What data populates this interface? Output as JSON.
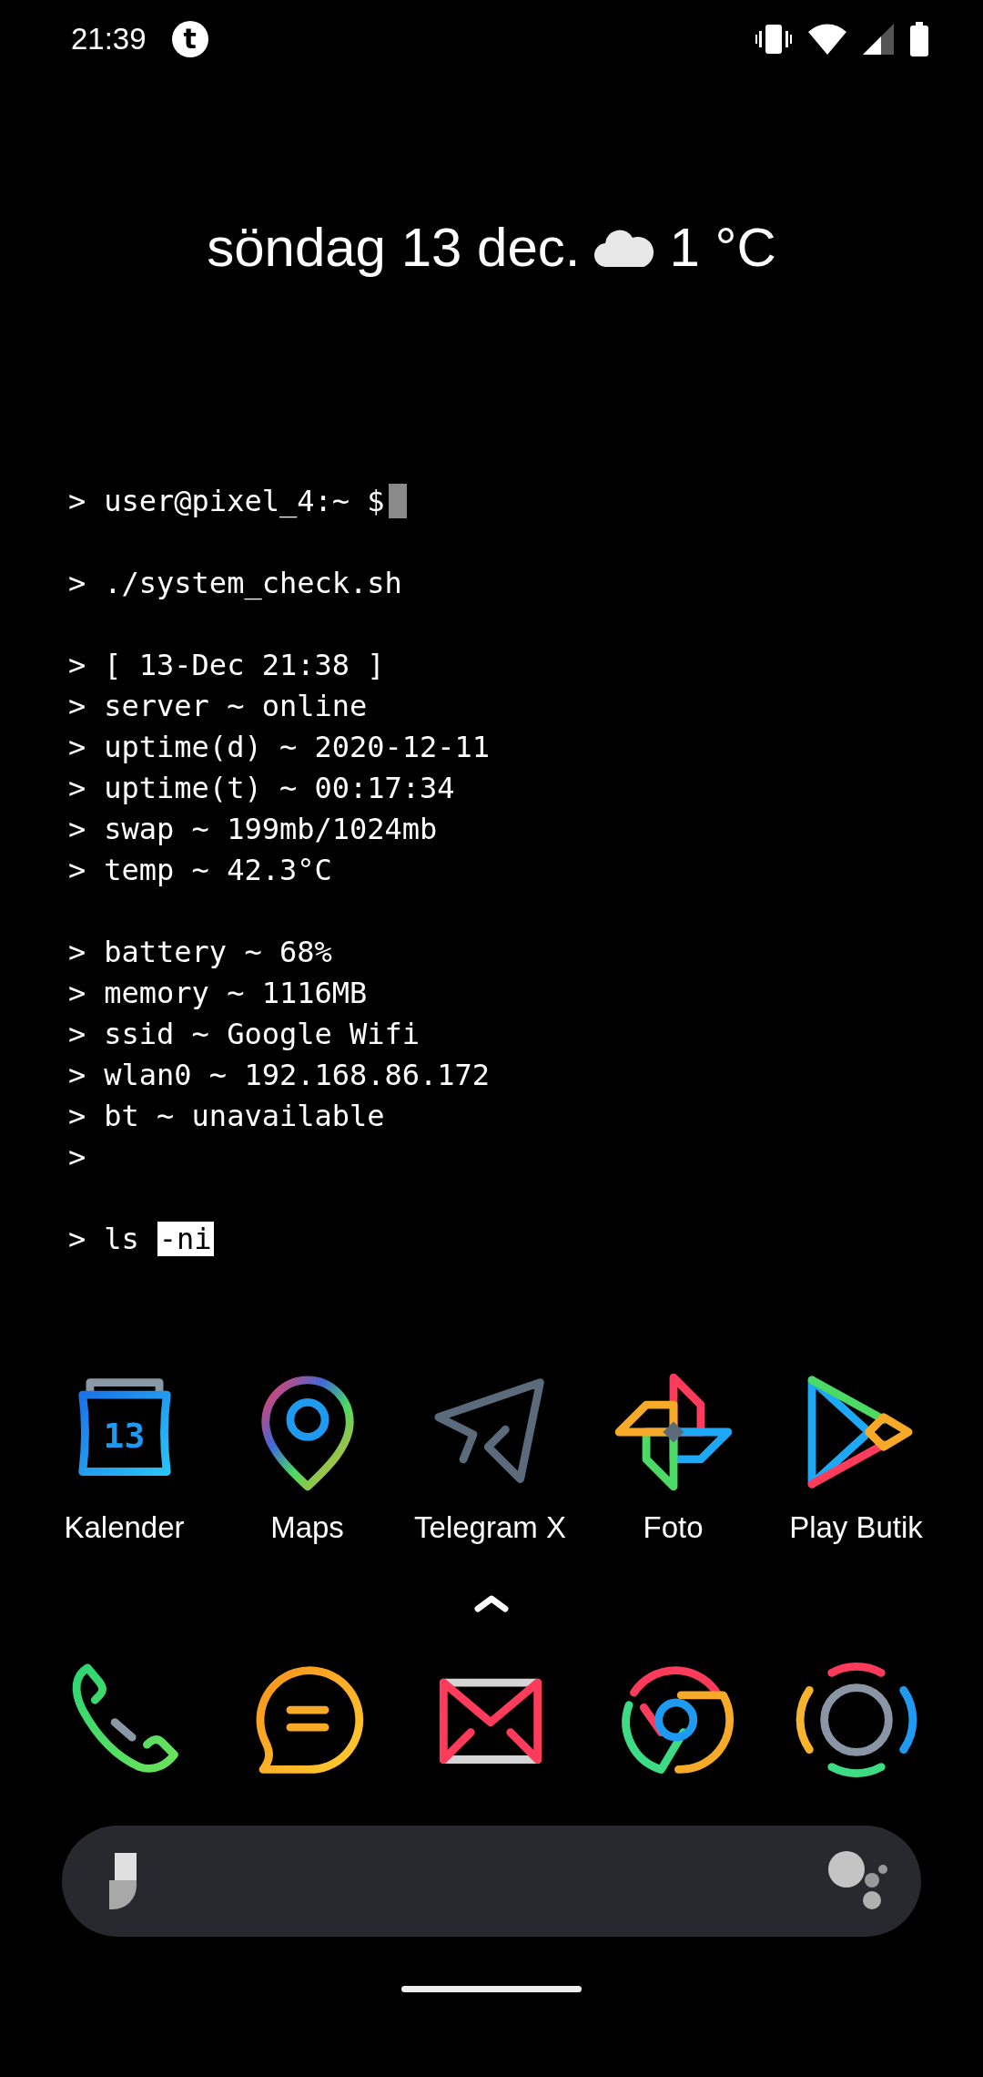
{
  "status_bar": {
    "time": "21:39",
    "notification": "t"
  },
  "date_widget": {
    "date": "söndag 13 dec.",
    "temperature": "1 °C"
  },
  "terminal": {
    "blocks": [
      [
        {
          "prompt": ">",
          "text": "user@pixel_4:~ $",
          "cursor": true
        }
      ],
      [
        {
          "prompt": ">",
          "text": "./system_check.sh",
          "cursor": false
        }
      ],
      [
        {
          "prompt": ">",
          "text": "[ 13-Dec 21:38 ]",
          "cursor": false
        },
        {
          "prompt": ">",
          "text": "server ~ online",
          "cursor": false
        },
        {
          "prompt": ">",
          "text": "uptime(d) ~ 2020-12-11",
          "cursor": false
        },
        {
          "prompt": ">",
          "text": "uptime(t) ~ 00:17:34",
          "cursor": false
        },
        {
          "prompt": ">",
          "text": "swap ~ 199mb/1024mb",
          "cursor": false
        },
        {
          "prompt": ">",
          "text": "temp ~ 42.3°C",
          "cursor": false
        }
      ],
      [
        {
          "prompt": ">",
          "text": "battery ~ 68%",
          "cursor": false
        },
        {
          "prompt": ">",
          "text": "memory ~ 1116MB",
          "cursor": false
        },
        {
          "prompt": ">",
          "text": "ssid ~ Google Wifi",
          "cursor": false
        },
        {
          "prompt": ">",
          "text": "wlan0 ~ 192.168.86.172",
          "cursor": false
        },
        {
          "prompt": ">",
          "text": "bt ~ unavailable",
          "cursor": false
        },
        {
          "prompt": ">",
          "cursor": false
        }
      ],
      [
        {
          "prompt": ">",
          "text": "ls",
          "highlight": "-ni",
          "cursor": false
        }
      ]
    ]
  },
  "apps": [
    {
      "label": "Kalender",
      "kind": "calendar",
      "badge": "13"
    },
    {
      "label": "Maps",
      "kind": "maps"
    },
    {
      "label": "Telegram X",
      "kind": "telegram"
    },
    {
      "label": "Foto",
      "kind": "photos"
    },
    {
      "label": "Play Butik",
      "kind": "play"
    }
  ],
  "dock": [
    {
      "kind": "phone"
    },
    {
      "kind": "messages"
    },
    {
      "kind": "mail"
    },
    {
      "kind": "chrome"
    },
    {
      "kind": "camera"
    }
  ]
}
